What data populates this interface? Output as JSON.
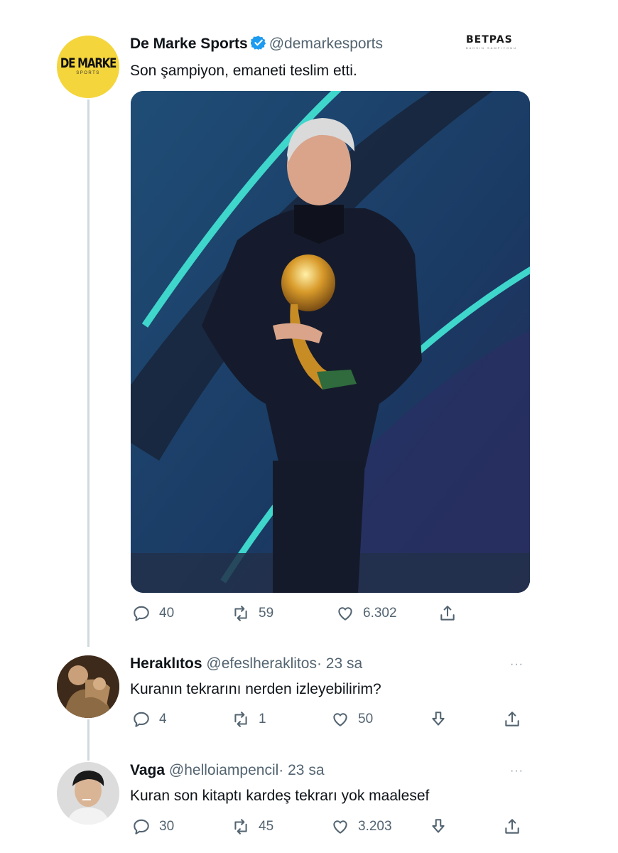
{
  "watermark": {
    "brand": "BETPAS",
    "tagline": "BAHSIN SAMPIYONU"
  },
  "tweet": {
    "avatar_text": "DE MARKE",
    "avatar_sub": "SPORTS",
    "name": "De Marke Sports",
    "handle": "@demarkesports",
    "verified": true,
    "text": "Son şampiyon, emaneti teslim etti.",
    "stats": {
      "replies": "40",
      "retweets": "59",
      "likes": "6.302"
    }
  },
  "replies": [
    {
      "name": "Heraklıtos",
      "handle": "@efeslheraklitos",
      "time": "· 23 sa",
      "text": "Kuranın tekrarını nerden izleyebilirim?",
      "stats": {
        "replies": "4",
        "retweets": "1",
        "likes": "50"
      },
      "more": "···"
    },
    {
      "name": "Vaga",
      "handle": "@helloiampencil",
      "time": "· 23 sa",
      "text": "Kuran son kitaptı kardeş tekrarı yok maalesef",
      "stats": {
        "replies": "30",
        "retweets": "45",
        "likes": "3.203"
      },
      "more": "···"
    }
  ],
  "colors": {
    "verified": "#1d9bf0",
    "secondary": "#536471",
    "avatar_yellow": "#f4d53c"
  }
}
